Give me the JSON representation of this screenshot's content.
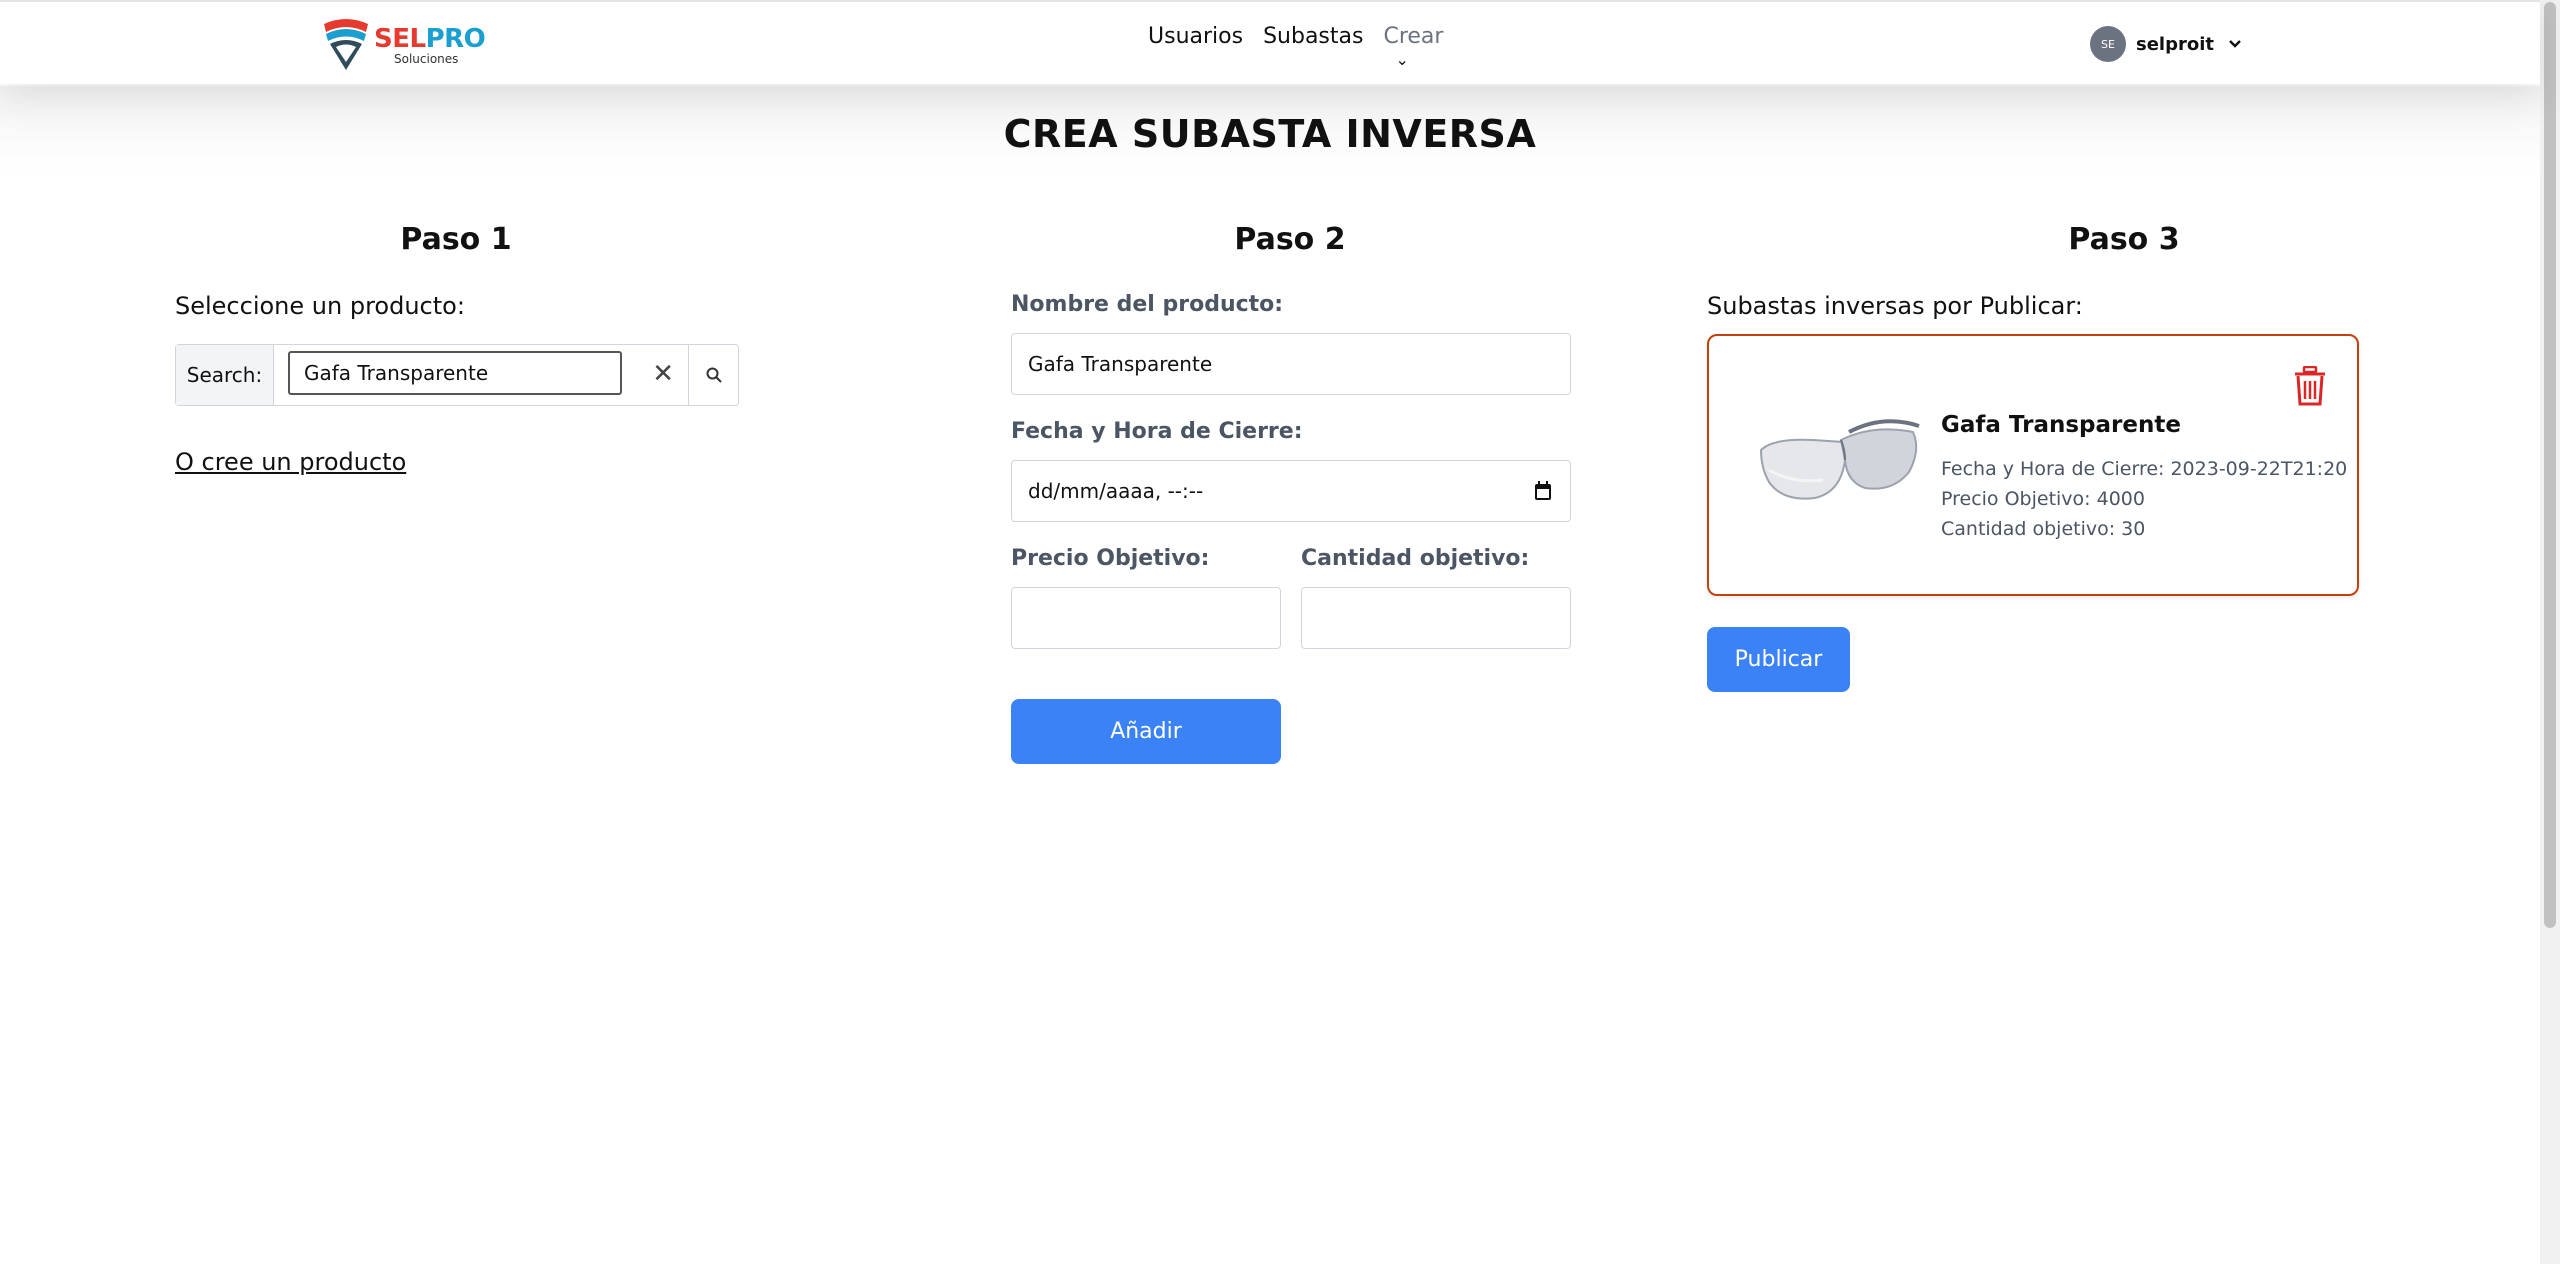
{
  "brand": {
    "name_a": "SEL",
    "name_b": "PRO",
    "subtitle": "Soluciones"
  },
  "nav": {
    "items": [
      {
        "label": "Usuarios"
      },
      {
        "label": "Subastas"
      },
      {
        "label": "Crear"
      }
    ],
    "user": {
      "initials": "SE",
      "name": "selproit"
    }
  },
  "page": {
    "title": "CREA SUBASTA INVERSA"
  },
  "step1": {
    "title": "Paso 1",
    "prompt": "Seleccione un producto:",
    "search_label": "Search:",
    "search_value": "Gafa Transparente",
    "create_link": "O cree un producto"
  },
  "step2": {
    "title": "Paso 2",
    "product_name_label": "Nombre del producto:",
    "product_name_value": "Gafa Transparente",
    "close_datetime_label": "Fecha y Hora de Cierre:",
    "close_datetime_placeholder": "dd/mm/aaaa, --:--",
    "target_price_label": "Precio Objetivo:",
    "target_qty_label": "Cantidad objetivo:",
    "add_button": "Añadir"
  },
  "step3": {
    "title": "Paso 3",
    "heading": "Subastas inversas por Publicar:",
    "card": {
      "title": "Gafa Transparente",
      "close_line": "Fecha y Hora de Cierre: 2023-09-22T21:20",
      "price_line": "Precio Objetivo: 4000",
      "qty_line": "Cantidad objetivo: 30"
    },
    "publish_button": "Publicar"
  },
  "colors": {
    "primary": "#3b82f6",
    "card_border": "#c2410c",
    "trash": "#dc2626"
  }
}
